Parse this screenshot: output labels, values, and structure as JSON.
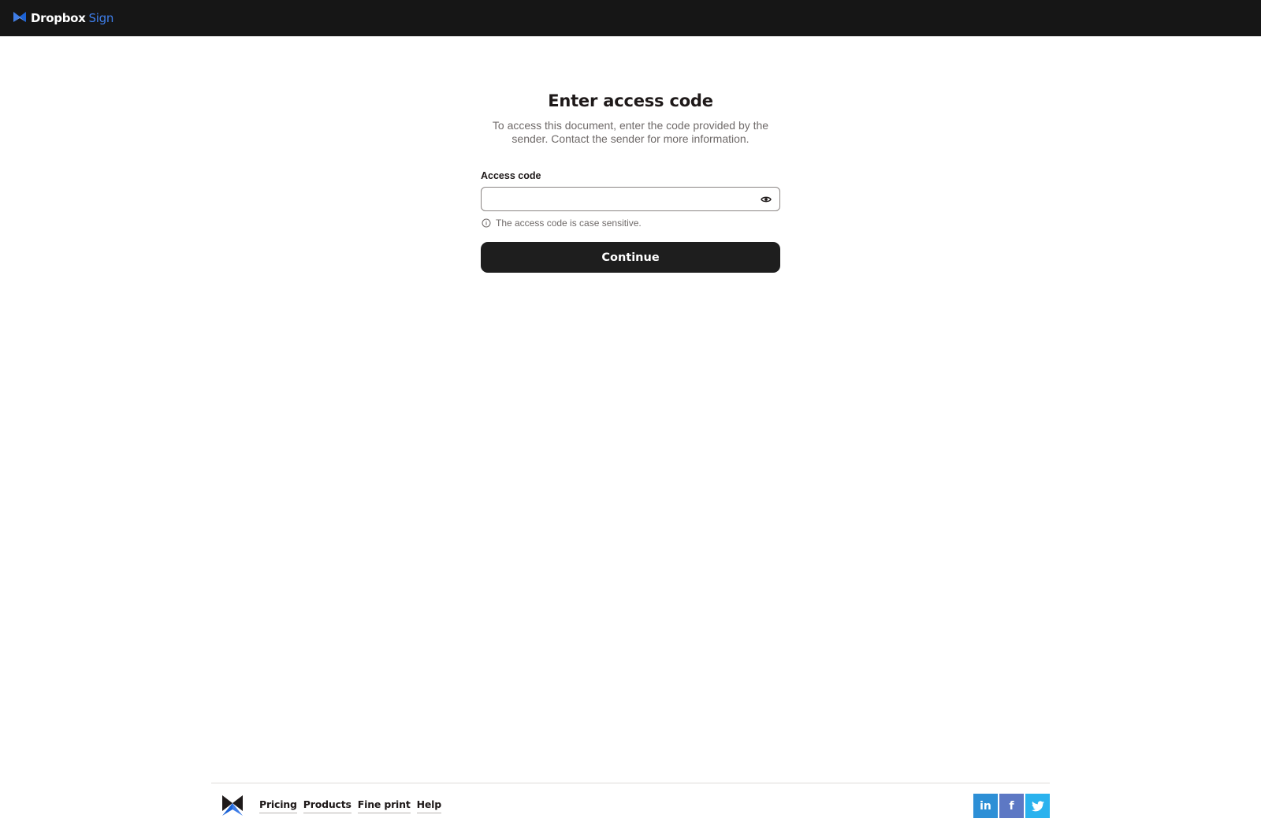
{
  "header": {
    "brand_name": "Dropbox",
    "brand_product": "Sign",
    "logo_icon": "dropbox-sign-logo-icon"
  },
  "main": {
    "title": "Enter access code",
    "subtitle": "To access this document, enter the code provided by the sender. Contact the sender for more information.",
    "field_label": "Access code",
    "field_value": "",
    "field_placeholder": "",
    "toggle_icon": "eye-icon",
    "hint_icon": "info-circle-icon",
    "hint_text": "The access code is case sensitive.",
    "continue_label": "Continue"
  },
  "footer": {
    "links": [
      "Pricing",
      "Products",
      "Fine print",
      "Help"
    ],
    "socials": [
      {
        "name": "linkedin",
        "glyph": "in",
        "color": "#2d8fd6"
      },
      {
        "name": "facebook",
        "glyph": "f",
        "color": "#5d78c4"
      },
      {
        "name": "twitter",
        "glyph": "twitter-bird-icon",
        "color": "#2ab2ee"
      }
    ]
  },
  "colors": {
    "topbar_bg": "#161616",
    "accent_blue": "#3e7de8",
    "button_bg": "#1e1e1e"
  }
}
